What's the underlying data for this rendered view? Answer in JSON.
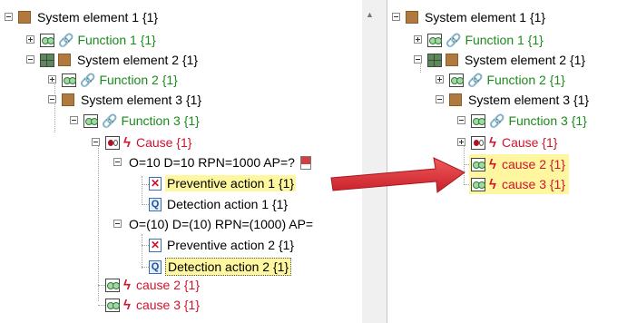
{
  "left_tree": {
    "system_element_1": "System element 1 {1}",
    "function_1": "Function 1 {1}",
    "system_element_2": "System element 2 {1}",
    "function_2": "Function 2 {1}",
    "system_element_3": "System element 3 {1}",
    "function_3": "Function 3 {1}",
    "cause": "Cause {1}",
    "risk_1": "O=10 D=10 RPN=1000 AP=?",
    "preventive_action_1": "Preventive action 1 {1}",
    "detection_action_1": "Detection action 1 {1}",
    "risk_2": "O=(10) D=(10) RPN=(1000) AP=",
    "preventive_action_2": "Preventive action 2 {1}",
    "detection_action_2": "Detection action 2 {1}",
    "cause_2": "cause 2 {1}",
    "cause_3": "cause 3 {1}"
  },
  "right_tree": {
    "system_element_1": "System element 1 {1}",
    "function_1": "Function 1 {1}",
    "system_element_2": "System element 2 {1}",
    "function_2": "Function 2 {1}",
    "system_element_3": "System element 3 {1}",
    "function_3": "Function 3 {1}",
    "cause": "Cause {1}",
    "cause_2": "cause 2 {1}",
    "cause_3": "cause 3 {1}"
  },
  "icons": {
    "system_element": "system-element-icon",
    "function_box": "function-box-icon",
    "function_link": "link-icon",
    "cause_box": "cause-box-icon",
    "cause_bolt": "bolt-icon",
    "preventive": "preventive-action-icon",
    "detection": "detection-action-icon",
    "report": "report-icon",
    "arrow": "red-arrow"
  },
  "colors": {
    "function_text": "#1c8a1c",
    "cause_text": "#d0142c",
    "highlight": "#fff7a0",
    "system_element_icon": "#b07a3e",
    "arrow": "#e0343a"
  }
}
